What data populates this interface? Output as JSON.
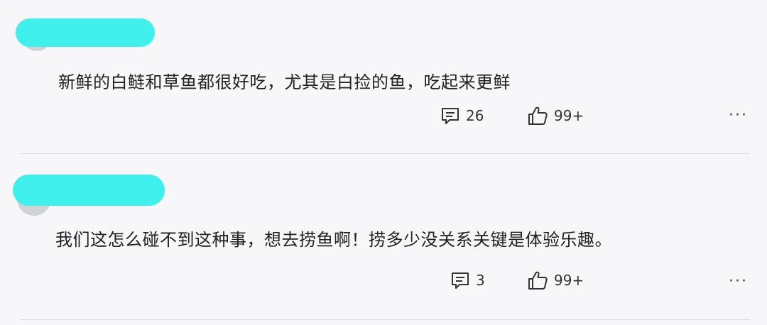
{
  "comments": [
    {
      "text": "新鲜的白鲢和草鱼都很好吃，尤其是白捡的鱼，吃起来更鲜",
      "reply_count": "26",
      "like_count": "99+",
      "more_label": "···"
    },
    {
      "text": "我们这怎么碰不到这种事，想去捞鱼啊！捞多少没关系关键是体验乐趣。",
      "reply_count": "3",
      "like_count": "99+",
      "more_label": "···"
    }
  ],
  "colors": {
    "redaction": "#3ff0ec",
    "background": "#f7f7f9",
    "divider": "#dcdcdf"
  },
  "icons": {
    "reply": "comment-bubble-icon",
    "like": "thumbs-up-icon"
  }
}
